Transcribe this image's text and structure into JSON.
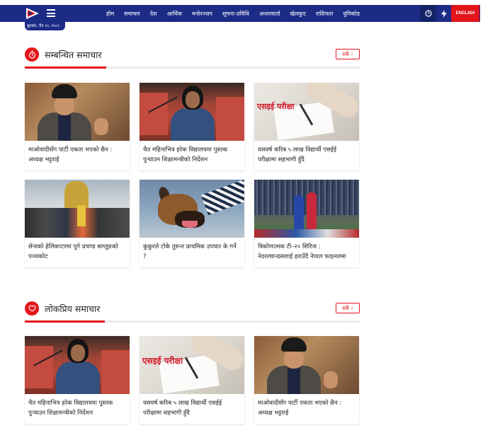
{
  "header": {
    "date": "बुधबार, चैत २०, २०८१",
    "nav": [
      "होम",
      "समाचार",
      "देश",
      "आर्थिक",
      "मनोरञ्जन",
      "सूचना-प्रविधि",
      "अन्तरवार्ता",
      "खेलकुद",
      "राशिफल",
      "युनिकोड"
    ],
    "english_label": "ENGLISH"
  },
  "related": {
    "title": "सम्बन्धित समाचार",
    "more": "सबै",
    "cards": [
      {
        "caption": "माओवादीसँग पार्टी एकता भएको छैन : अध्यक्ष भट्टराई"
      },
      {
        "caption": "चैत महिनाभित्र हरेक विद्यालयमा पुस्तक पुर्‍याउन शिक्षामन्त्रीको निर्देशन"
      },
      {
        "caption": "यसवर्ष करिब ५ लाख विद्यार्थी एसईई परीक्षामा सहभागी हुँदै",
        "thumb_text": "एसइई परीक्षा"
      },
      {
        "caption": "सेनाको हेलिकप्टरमा पुगे प्रचण्ड बाग्लुङको पञ्चकोट"
      },
      {
        "caption": "कुकुरले टोके तुरुन्त प्राथमिक उपचार के गर्ने ?"
      },
      {
        "caption": "त्रिकोणात्मक टी–२० सिरिज : नेदरल्यान्डसलाई हराउँदै नेपाल फाइनलमा"
      }
    ]
  },
  "popular": {
    "title": "लोकप्रिय समाचार",
    "more": "सबै",
    "cards": [
      {
        "caption": "चैत महिनाभित्र हरेक विद्यालयमा पुस्तक पुर्‍याउन शिक्षामन्त्रीको निर्देशन"
      },
      {
        "caption": "यसवर्ष करिब ५ लाख विद्यार्थी एसईई परीक्षामा सहभागी हुँदै",
        "thumb_text": "एसइई परीक्षा"
      },
      {
        "caption": "माओवादीसँग पार्टी एकता भएको छैन : अध्यक्ष भट्टराई"
      }
    ]
  },
  "colors": {
    "nav_bg": "#1b2b86",
    "accent": "#e3151b"
  }
}
